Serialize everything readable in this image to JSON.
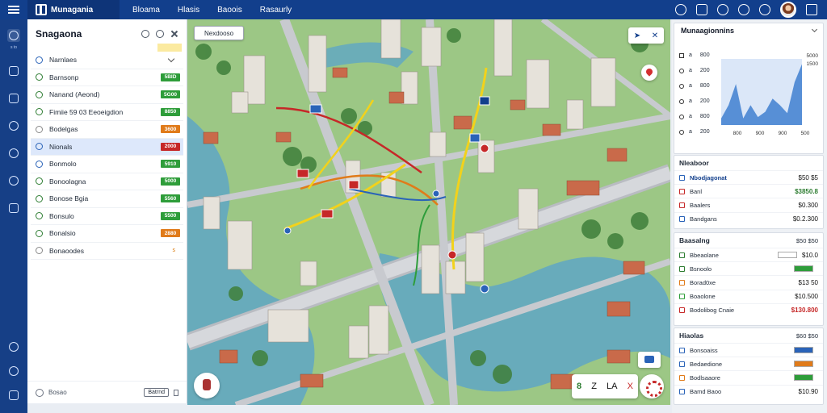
{
  "app": {
    "logo_text": "Munagania",
    "nav": [
      "Bloama",
      "Hlasis",
      "Baoois",
      "Rasaurly"
    ]
  },
  "rail": {
    "active_label": "s to",
    "bottom_labels": []
  },
  "panel": {
    "title": "Snagaona",
    "layers": [
      {
        "label": "Narnlaes",
        "badge": null,
        "badge_color": null,
        "icon_color": "#2a63b8",
        "trailing": "chevron"
      },
      {
        "label": "Barnsonp",
        "badge": "5BID",
        "badge_color": "#2e9d3a",
        "icon_color": "#2e7d32"
      },
      {
        "label": "Nanand (Aeond)",
        "badge": "5G00",
        "badge_color": "#2e9d3a",
        "icon_color": "#2e7d32"
      },
      {
        "label": "Fimiie 59 03 Eeoeigdion",
        "badge": "8850",
        "badge_color": "#2e9d3a",
        "icon_color": "#2e7d32"
      },
      {
        "label": "Bodelgas",
        "badge": "3600",
        "badge_color": "#e07b1a",
        "icon_color": "#888"
      },
      {
        "label": "Nionals",
        "badge": "2000",
        "badge_color": "#c62828",
        "icon_color": "#2a63b8"
      },
      {
        "label": "Bonmolo",
        "badge": "5910",
        "badge_color": "#2e9d3a",
        "icon_color": "#2a63b8"
      },
      {
        "label": "Bonoolagna",
        "badge": "5000",
        "badge_color": "#2e9d3a",
        "icon_color": "#2e7d32"
      },
      {
        "label": "Bonose Bgia",
        "badge": "5560",
        "badge_color": "#2e9d3a",
        "icon_color": "#2e7d32"
      },
      {
        "label": "Bonsulo",
        "badge": "5500",
        "badge_color": "#2e9d3a",
        "icon_color": "#2e7d32"
      },
      {
        "label": "Bonalsio",
        "badge": "2880",
        "badge_color": "#e07b1a",
        "icon_color": "#2e7d32"
      },
      {
        "label": "Bonaoodes",
        "badge": null,
        "badge_color": null,
        "icon_color": "#888",
        "trailing": "s"
      }
    ],
    "footer_text": "Bosao",
    "footer_button": "Batrnd"
  },
  "map": {
    "search_label": "Nexdooso",
    "ctrl_icons": [
      "navigate-icon",
      "close-icon"
    ],
    "tools": [
      "8",
      "Z",
      "LA",
      "X"
    ]
  },
  "stats": {
    "title": "Munaagionnins",
    "rows": [
      {
        "label": "a",
        "value": "800"
      },
      {
        "label": "a",
        "value": "200"
      },
      {
        "label": "a",
        "value": "800"
      },
      {
        "label": "a",
        "value": "200"
      },
      {
        "label": "a",
        "value": "800"
      },
      {
        "label": "a",
        "value": "200"
      }
    ],
    "top_right_values": [
      "5000",
      "1500"
    ]
  },
  "chart_data": {
    "type": "area",
    "title": "",
    "xlabel": "",
    "ylabel": "",
    "categories": [
      "800",
      "900",
      "900",
      "500"
    ],
    "series": [
      {
        "values": [
          10,
          30,
          62,
          10,
          30,
          12,
          20,
          40,
          30,
          18,
          65,
          92
        ]
      }
    ],
    "y_ticks": [
      "5000",
      "1500"
    ],
    "ylim": [
      0,
      100
    ]
  },
  "section_hubs": {
    "title": "Nleaboor",
    "top_value": "",
    "rows": [
      {
        "label": "Nbodjagonat",
        "value": "$50 $5",
        "style": "link",
        "icon_color": "#2a63b8"
      },
      {
        "label": "Banl",
        "value": "$3850.8",
        "style": "green",
        "icon_color": "#c62828"
      },
      {
        "label": "Baalers",
        "value": "$0.300",
        "style": "normal",
        "icon_color": "#c62828"
      },
      {
        "label": "Bandgans",
        "value": "$0.2.300",
        "style": "normal",
        "icon_color": "#2a63b8"
      }
    ]
  },
  "section_routing": {
    "title": "Baasalng",
    "top_value": "$50 $50",
    "rows": [
      {
        "label": "Bbeaolane",
        "value": "$10.0",
        "style": "normal",
        "bar": "#ffffff",
        "icon_color": "#2e7d32"
      },
      {
        "label": "Bsnoolo",
        "value": "",
        "style": "normal",
        "bar": "#2e9d3a",
        "icon_color": "#2e7d32"
      },
      {
        "label": "Borad0xe",
        "value": "$13 50",
        "style": "normal",
        "bar": null,
        "icon_color": "#e07b1a"
      },
      {
        "label": "Boaolone",
        "value": "$10.500",
        "style": "normal",
        "bar": null,
        "icon_color": "#2e9d3a"
      },
      {
        "label": "Bodolibog Cnaie",
        "value": "$130.800",
        "style": "red",
        "bar": null,
        "icon_color": "#c62828"
      }
    ]
  },
  "section_kpi": {
    "title": "Hiaolas",
    "top_value": "$60 $50",
    "rows": [
      {
        "label": "Bonsoaiss",
        "value": "",
        "bar": "#2a63b8",
        "icon_color": "#2a63b8"
      },
      {
        "label": "Bedaedione",
        "value": "",
        "bar": "#e07b1a",
        "icon_color": "#2a63b8"
      },
      {
        "label": "Bodlsaaore",
        "value": "",
        "bar": "#2e9d3a",
        "icon_color": "#e07b1a"
      },
      {
        "label": "Bamd Baoo",
        "value": "$10.90",
        "bar": null,
        "icon_color": "#2a63b8"
      }
    ]
  }
}
